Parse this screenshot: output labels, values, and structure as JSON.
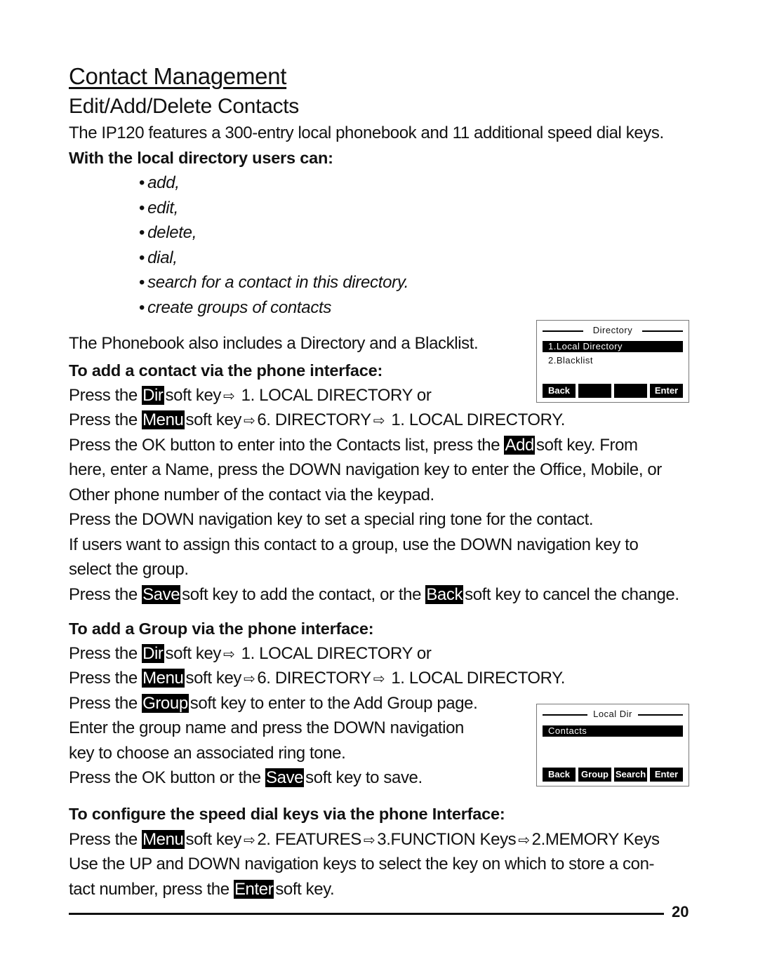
{
  "page": {
    "title": "Contact Management",
    "subtitle": "Edit/Add/Delete Contacts",
    "intro": "The IP120 features a 300-entry local phonebook and 11 additional speed dial keys.",
    "users_can_heading": "With the local directory users can:",
    "bullets": [
      "add,",
      "edit,",
      "delete,",
      "dial,",
      "search for a contact in this directory.",
      "create groups of contacts"
    ],
    "bullet_char": "•",
    "phonebook_note": "The Phonebook also includes a Directory and a Blacklist.",
    "add_contact": {
      "heading": "To add a contact via the phone interface:",
      "line1": {
        "pre": "Press the ",
        "key": "Dir",
        "post": "soft key",
        "arrow": "⇨",
        "rest": " 1. LOCAL DIRECTORY  or"
      },
      "line2": {
        "pre": "Press the ",
        "key": "Menu",
        "post": "soft key",
        "arrow": "⇨",
        "mid": "6. DIRECTORY",
        "arrow2": "⇨",
        "rest": " 1. LOCAL DIRECTORY."
      },
      "line3": {
        "pre": "Press the OK button to enter into the Contacts list, press the ",
        "key": "Add",
        "post": "soft key.  From"
      },
      "line4": "here, enter a Name, press the DOWN navigation key to enter the Office, Mobile, or",
      "line5": "Other phone number of the contact via the keypad.",
      "line6": "Press the DOWN navigation key to set a special ring tone for the contact.",
      "line7": "If users want to assign this contact to a group, use the DOWN navigation key to",
      "line8": "select the group.",
      "line9": {
        "pre": "Press the ",
        "key": "Save",
        "mid": "soft key to add the contact, or the ",
        "key2": "Back",
        "post": "soft key to cancel the change."
      }
    },
    "add_group": {
      "heading": "To add a Group via the phone interface:",
      "line1": {
        "pre": "Press the ",
        "key": "Dir",
        "post": "soft key",
        "arrow": "⇨",
        "rest": " 1. LOCAL DIRECTORY  or"
      },
      "line2": {
        "pre": "Press the ",
        "key": "Menu",
        "post": "soft key",
        "arrow": "⇨",
        "mid": "6. DIRECTORY",
        "arrow2": "⇨",
        "rest": " 1. LOCAL DIRECTORY."
      },
      "line3": {
        "pre": "Press the ",
        "key": "Group",
        "post": "soft key to enter to the Add Group page."
      },
      "line4": "Enter the group name and press the DOWN navigation",
      "line5": "key to choose an associated ring tone.",
      "line6": {
        "pre": "Press the OK button or the ",
        "key": "Save",
        "post": "soft key to save."
      }
    },
    "speed_dial": {
      "heading": "To configure the speed dial keys via the phone Interface:",
      "line1": {
        "pre": "Press the ",
        "key": "Menu",
        "post": "soft key",
        "arrow": "⇨",
        "a": "2. FEATURES",
        "arrow2": "⇨",
        "b": "3.FUNCTION Keys",
        "arrow3": "⇨",
        "c": "2.MEMORY Keys"
      },
      "line2": "Use the UP and DOWN navigation keys to select the key on which to store a con-",
      "line3": {
        "pre": "tact number, press the ",
        "key": "Enter",
        "post": "soft key."
      }
    },
    "page_number": "20"
  },
  "screens": {
    "directory": {
      "title": "Directory",
      "rows": [
        "1.Local  Directory",
        "2.Blacklist"
      ],
      "selected_index": 0,
      "softkeys": [
        "Back",
        "",
        "",
        "Enter"
      ]
    },
    "local_dir": {
      "title": "Local  Dir",
      "rows": [
        "Contacts"
      ],
      "selected_index": 0,
      "softkeys": [
        "Back",
        "Group",
        "Search",
        "Enter"
      ]
    }
  }
}
